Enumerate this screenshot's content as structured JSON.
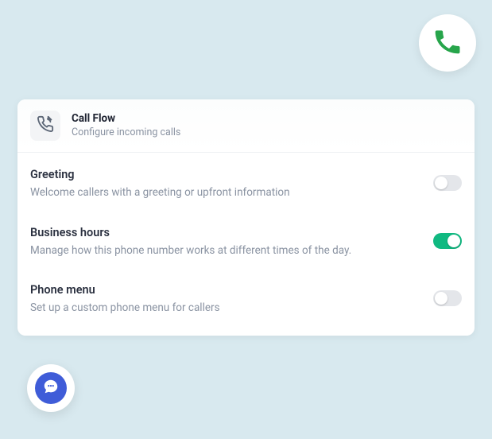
{
  "colors": {
    "accent_green": "#10b981",
    "toggle_off": "#e4e6ea",
    "fab_blue": "#3f5cd8",
    "bg": "#d8e9ef"
  },
  "header": {
    "title": "Call Flow",
    "subtitle": "Configure incoming calls",
    "icon": "incoming-call-icon"
  },
  "badge": {
    "icon": "phone-icon"
  },
  "settings": [
    {
      "key": "greeting",
      "title": "Greeting",
      "description": "Welcome callers with a greeting or upfront information",
      "enabled": false
    },
    {
      "key": "business_hours",
      "title": "Business hours",
      "description": "Manage how this phone number works at different times of the day.",
      "enabled": true
    },
    {
      "key": "phone_menu",
      "title": "Phone menu",
      "description": "Set up a custom phone menu for callers",
      "enabled": false
    }
  ],
  "fab": {
    "icon": "chat-icon"
  }
}
